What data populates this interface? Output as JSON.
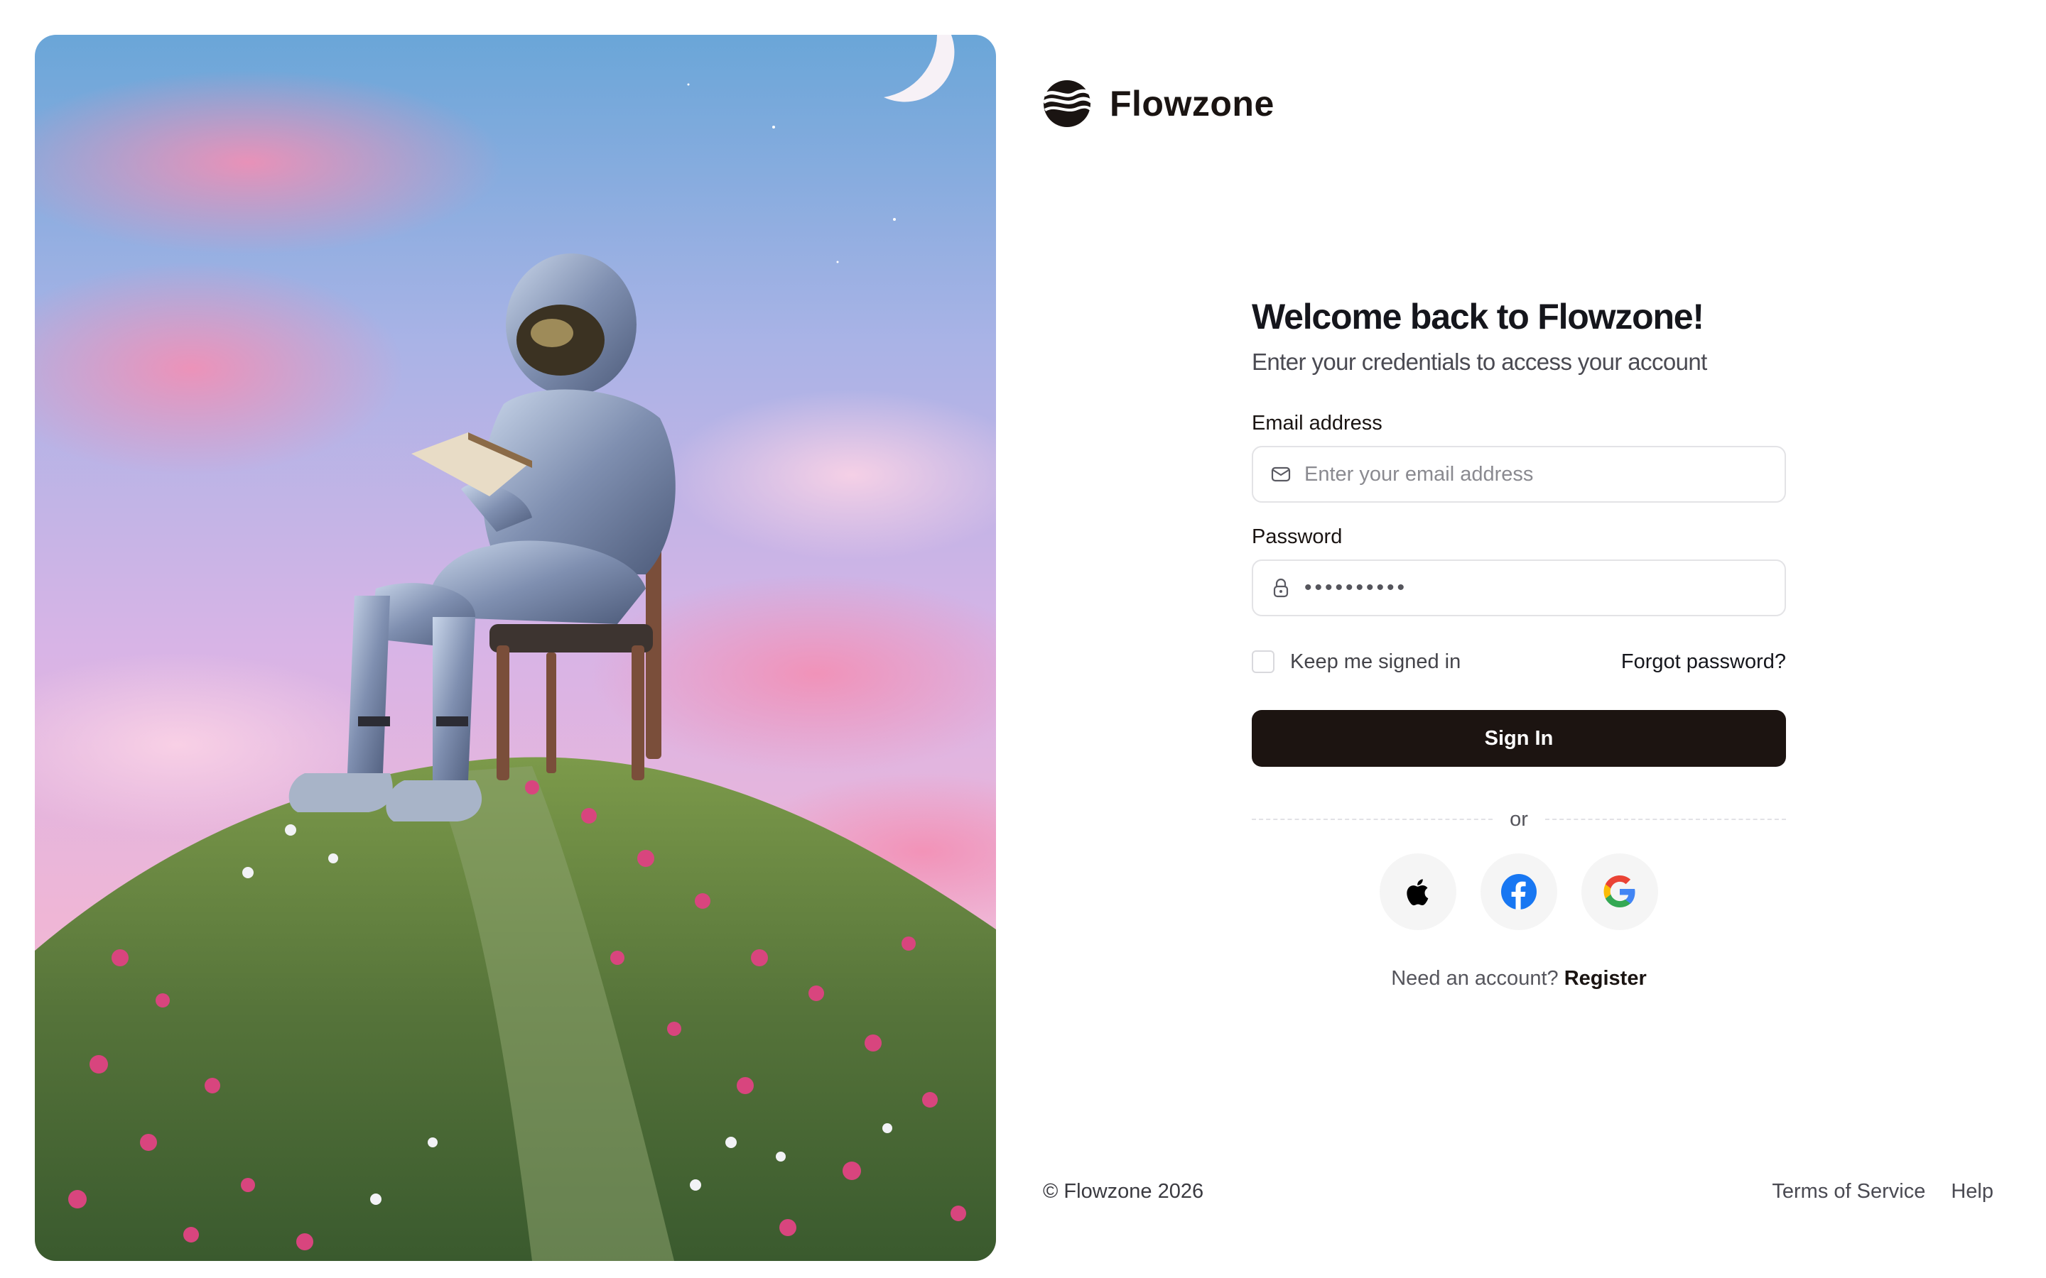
{
  "brand": {
    "name": "Flowzone"
  },
  "form": {
    "heading": "Welcome back to Flowzone!",
    "subheading": "Enter your credentials to access your account",
    "email": {
      "label": "Email address",
      "placeholder": "Enter your email address",
      "value": ""
    },
    "password": {
      "label": "Password",
      "value": "••••••••••"
    },
    "remember": {
      "label": "Keep me signed in",
      "checked": false
    },
    "forgot_label": "Forgot password?",
    "submit_label": "Sign In",
    "divider_label": "or",
    "social": [
      {
        "provider": "Apple",
        "icon": "apple-icon"
      },
      {
        "provider": "Facebook",
        "icon": "facebook-icon"
      },
      {
        "provider": "Google",
        "icon": "google-icon"
      }
    ],
    "register_prompt": "Need an account?",
    "register_link": "Register"
  },
  "footer": {
    "copyright": "© Flowzone 2026",
    "links": [
      "Terms of Service",
      "Help"
    ]
  },
  "colors": {
    "primary_button": "#1c1411",
    "text_dark": "#15161c",
    "border": "#e3e3e6",
    "facebook_blue": "#1877f2"
  }
}
